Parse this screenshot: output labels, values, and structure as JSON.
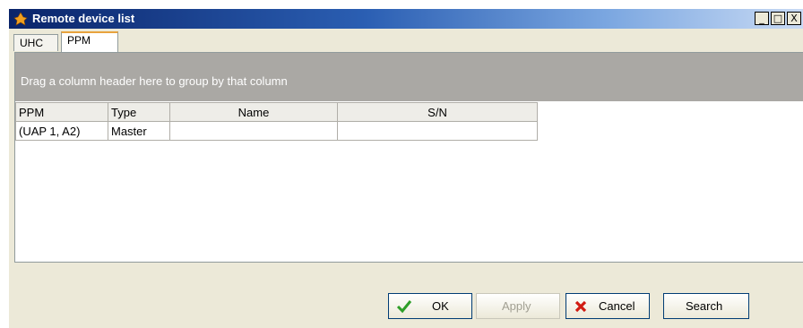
{
  "window": {
    "title": "Remote device list",
    "controls": {
      "minimize": "_",
      "maximize": "□",
      "close": "X"
    }
  },
  "tabs": [
    {
      "label": "UHC",
      "active": false
    },
    {
      "label": "PPM",
      "active": true
    }
  ],
  "grid": {
    "group_hint": "Drag a column header here to group by that column",
    "columns": [
      "PPM",
      "Type",
      "Name",
      "S/N"
    ],
    "rows": [
      [
        "(UAP 1, A2)",
        "Master",
        "",
        ""
      ]
    ]
  },
  "buttons": {
    "ok": "OK",
    "apply": "Apply",
    "cancel": "Cancel",
    "search": "Search"
  },
  "colors": {
    "title_gradient_start": "#0a246a",
    "ok_check": "#2e9e28",
    "cancel_x": "#d11b12",
    "tab_accent": "#e8a33d"
  }
}
